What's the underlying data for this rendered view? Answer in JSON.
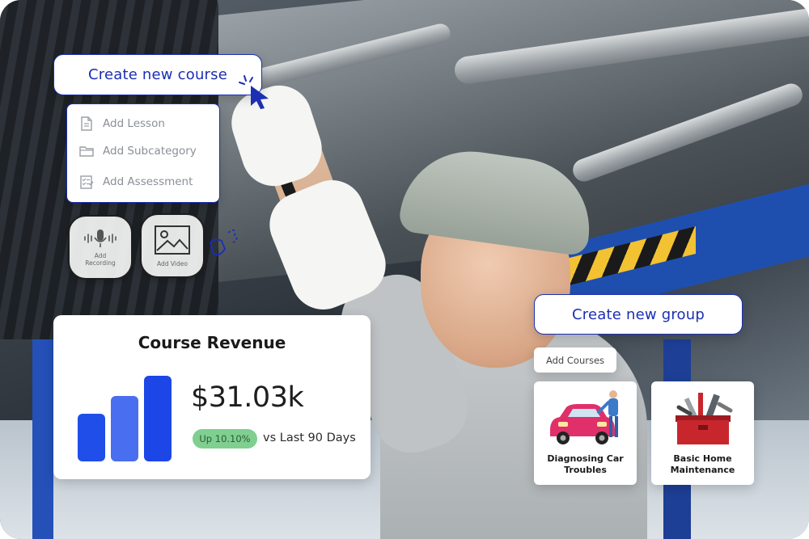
{
  "course_builder": {
    "title": "Create new course",
    "menu": [
      {
        "label": "Add Lesson",
        "icon": "document-icon"
      },
      {
        "label": "Add Subcategory",
        "icon": "folder-icon"
      },
      {
        "label": "Add Assessment",
        "icon": "checklist-icon"
      }
    ],
    "media": [
      {
        "label_line1": "Add",
        "label_line2": "Recording",
        "icon": "microphone-icon"
      },
      {
        "label_line1": "Add Video",
        "label_line2": "",
        "icon": "image-icon"
      }
    ]
  },
  "revenue": {
    "title": "Course Revenue",
    "amount": "$31.03k",
    "change_badge": "Up 10.10%",
    "comparison": "vs Last 90 Days",
    "bar_levels": [
      0.56,
      0.76,
      1.0
    ],
    "bar_colors": [
      "#1f4ee8",
      "#4a6ef0",
      "#1c47e6"
    ]
  },
  "group_builder": {
    "title": "Create new group",
    "add_courses_label": "Add Courses",
    "courses": [
      {
        "label": "Diagnosing Car Troubles",
        "icon": "car-mechanic-icon"
      },
      {
        "label": "Basic Home Maintenance",
        "icon": "toolbox-icon"
      }
    ]
  },
  "colors": {
    "accent": "#1b2fb3",
    "badge_green": "#7fcf90"
  }
}
